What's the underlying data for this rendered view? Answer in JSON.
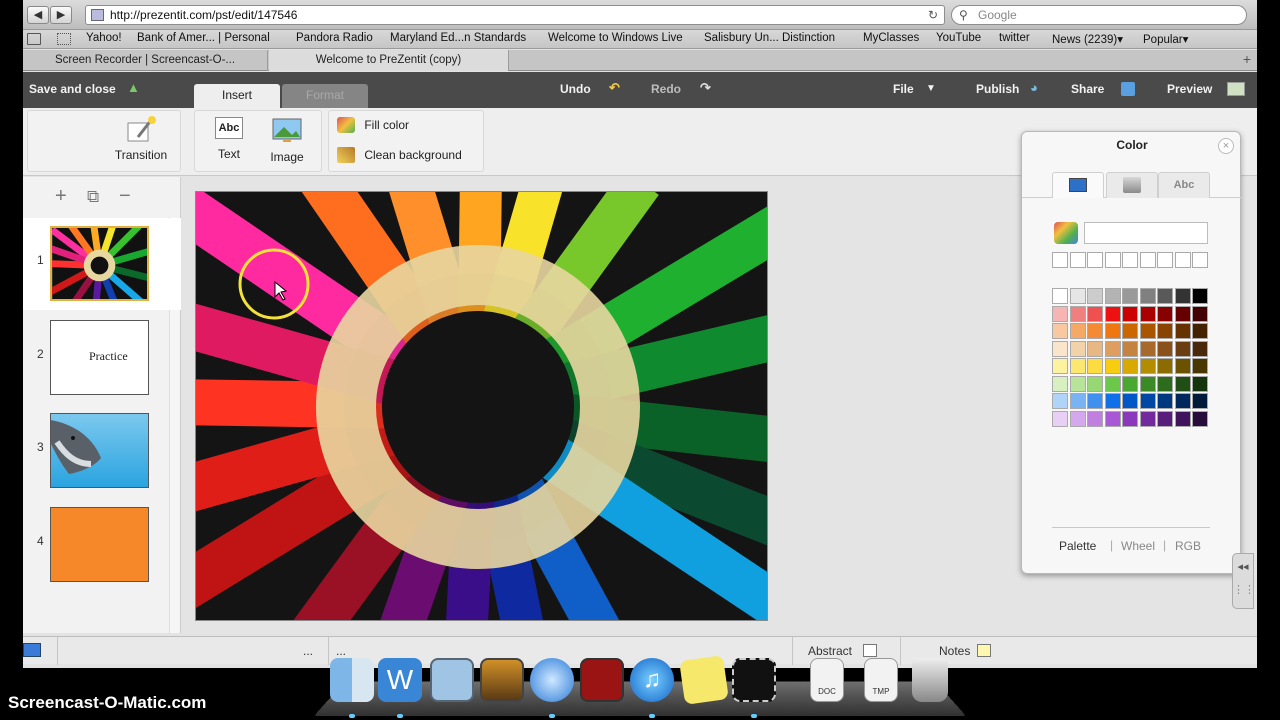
{
  "browser": {
    "back_label": "◀",
    "forward_label": "▶",
    "newtab_label": "+",
    "url": "http://prezentit.com/pst/edit/147546",
    "search_placeholder": "Google",
    "bookmarks": [
      "Yahoo!",
      "Bank of Amer... | Personal",
      "Pandora Radio",
      "Maryland Ed...n Standards",
      "Welcome to Windows Live",
      "Salisbury Un... Distinction",
      "MyClasses",
      "YouTube",
      "twitter",
      "News (2239)",
      "Popular"
    ],
    "bookmark_dropdown": "▾",
    "tabs": [
      "Screen Recorder | Screencast-O-...",
      "Welcome to PreZentit (copy)"
    ],
    "newtab_plus": "+"
  },
  "toolbar": {
    "save_label": "Save and close",
    "tab_insert": "Insert",
    "tab_format": "Format",
    "undo_label": "Undo",
    "redo_label": "Redo",
    "file_label": "File",
    "file_arrow": "▼",
    "publish_label": "Publish",
    "share_label": "Share",
    "preview_label": "Preview"
  },
  "ribbon": {
    "transition_label": "Transition",
    "text_label": "Text",
    "text_icon_label": "Abc",
    "image_label": "Image",
    "fill_color_label": "Fill color",
    "clean_background_label": "Clean background"
  },
  "sidebar": {
    "add_icon": "+",
    "duplicate_icon": "⧉",
    "remove_icon": "−",
    "slides": [
      {
        "number": "1",
        "kind": "image-pencils"
      },
      {
        "number": "2",
        "kind": "text",
        "text": "Practice"
      },
      {
        "number": "3",
        "kind": "image-dolphin"
      },
      {
        "number": "4",
        "kind": "solid",
        "color": "#f7882a"
      }
    ]
  },
  "color_panel": {
    "title": "Color",
    "close_label": "×",
    "tab_text_label": "Abc",
    "modes": [
      "Palette",
      "Wheel",
      "RGB"
    ],
    "mode_separator": "|",
    "palette": [
      [
        "#ffffff",
        "#e6e6e6",
        "#cccccc",
        "#b3b3b3",
        "#999999",
        "#808080",
        "#595959",
        "#333333",
        "#000000"
      ],
      [
        "#f6b4b4",
        "#f08080",
        "#ef5050",
        "#ee1111",
        "#cc0000",
        "#aa0000",
        "#880000",
        "#660000",
        "#440000"
      ],
      [
        "#f8c8a0",
        "#f6a866",
        "#f48a33",
        "#ee7711",
        "#cc6600",
        "#aa5500",
        "#884400",
        "#663300",
        "#442200"
      ],
      [
        "#f9e4cc",
        "#f2d2a8",
        "#e8b884",
        "#dd9e60",
        "#c4843f",
        "#a86a2a",
        "#8a521a",
        "#6a3d12",
        "#4a280a"
      ],
      [
        "#fdf2a0",
        "#fce870",
        "#fcdc40",
        "#f8cc10",
        "#d8aa00",
        "#b48c00",
        "#8c6c00",
        "#6a5200",
        "#483800"
      ],
      [
        "#d8f0c0",
        "#b8e49a",
        "#98d874",
        "#6cc84a",
        "#48a830",
        "#3a8a26",
        "#2c6c1c",
        "#204e14",
        "#14340c"
      ],
      [
        "#b0d4f8",
        "#78b4f4",
        "#4090f0",
        "#1070e8",
        "#0058c8",
        "#0048a4",
        "#003880",
        "#00285c",
        "#001a3c"
      ],
      [
        "#e8d0f4",
        "#d4a8ec",
        "#c080e0",
        "#a858d4",
        "#8c38bc",
        "#722a9c",
        "#581e7c",
        "#40145c",
        "#280c3c"
      ]
    ],
    "recent": [
      "#ffffff",
      "#ffffff",
      "#ffffff",
      "#ffffff",
      "#ffffff",
      "#ffffff",
      "#ffffff",
      "#ffffff",
      "#ffffff"
    ]
  },
  "statusbar": {
    "dots_left": "...",
    "dots_right": "...",
    "abstract_label": "Abstract",
    "notes_label": "Notes"
  },
  "dock": {
    "doc_label": "DOC",
    "tmp_label": "TMP"
  },
  "watermark": "Screencast-O-Matic.com"
}
